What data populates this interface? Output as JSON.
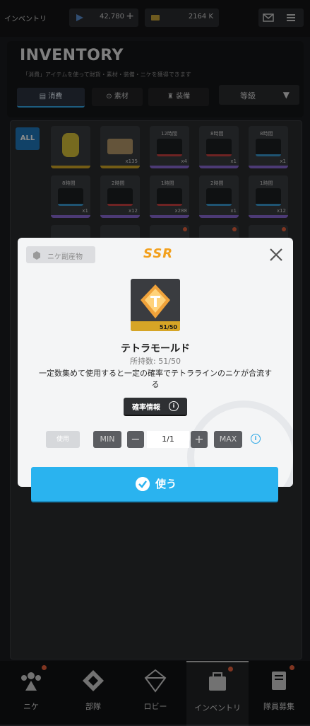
{
  "topbar": {
    "title": "インベントリ",
    "currency1": "42,780",
    "currency2": "2164 K"
  },
  "inventory": {
    "title": "INVENTORY",
    "subtitle": "「消費」アイテムを使って財貨・素材・装備・ニケを獲得できます",
    "tabs": [
      "消費",
      "素材",
      "装備"
    ],
    "sort_label": "等級",
    "filter_all": "ALL"
  },
  "grid": {
    "cells": [
      {
        "tag": "",
        "count": ""
      },
      {
        "tag": "",
        "count": "x135"
      },
      {
        "tag": "12時間",
        "count": "x4"
      },
      {
        "tag": "8時間",
        "count": "x1"
      },
      {
        "tag": "8時間",
        "count": "x1"
      },
      {
        "tag": "8時間",
        "count": "x1"
      },
      {
        "tag": "2時間",
        "count": "x12"
      },
      {
        "tag": "1時間",
        "count": "x288"
      },
      {
        "tag": "2時間",
        "count": "x1"
      },
      {
        "tag": "1時間",
        "count": "x12"
      }
    ]
  },
  "bottom_nav": {
    "items": [
      "ニケ",
      "部隊",
      "ロビー",
      "インベントリ",
      "隊員募集"
    ]
  },
  "modal": {
    "category": "ニケ副産物",
    "rarity": "SSR",
    "item_count": "51/50",
    "item_name": "テトラモールド",
    "owned": "所持数: 51/50",
    "description": "一定数集めて使用すると一定の確率でテトララインのニケが合流する",
    "prob_button": "確率情報",
    "use_label": "使用",
    "min_label": "MIN",
    "quantity": "1/1",
    "max_label": "MAX",
    "use_button": "使う"
  },
  "colors": {
    "accent": "#2ab3ef",
    "ssr": "#f2a01d",
    "notification": "#e8613c"
  }
}
